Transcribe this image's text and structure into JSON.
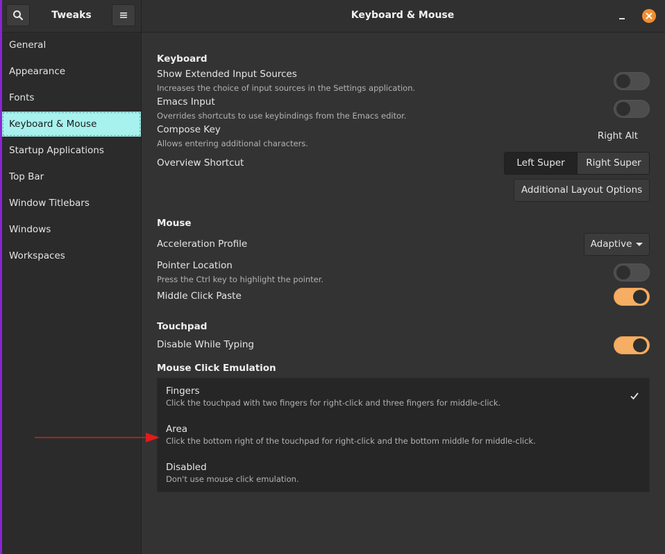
{
  "app": {
    "sidebar_title": "Tweaks",
    "page_title": "Keyboard & Mouse"
  },
  "sidebar": {
    "items": [
      {
        "label": "General",
        "selected": false
      },
      {
        "label": "Appearance",
        "selected": false
      },
      {
        "label": "Fonts",
        "selected": false
      },
      {
        "label": "Keyboard & Mouse",
        "selected": true
      },
      {
        "label": "Startup Applications",
        "selected": false
      },
      {
        "label": "Top Bar",
        "selected": false
      },
      {
        "label": "Window Titlebars",
        "selected": false
      },
      {
        "label": "Windows",
        "selected": false
      },
      {
        "label": "Workspaces",
        "selected": false
      }
    ]
  },
  "keyboard": {
    "section_title": "Keyboard",
    "extended_sources": {
      "label": "Show Extended Input Sources",
      "description": "Increases the choice of input sources in the Settings application.",
      "enabled": false
    },
    "emacs_input": {
      "label": "Emacs Input",
      "description": "Overrides shortcuts to use keybindings from the Emacs editor.",
      "enabled": false
    },
    "compose_key": {
      "label": "Compose Key",
      "description": "Allows entering additional characters.",
      "value": "Right Alt"
    },
    "overview_shortcut": {
      "label": "Overview Shortcut",
      "options": [
        "Left Super",
        "Right Super"
      ],
      "selected": "Left Super"
    },
    "additional_layout_button": "Additional Layout Options"
  },
  "mouse": {
    "section_title": "Mouse",
    "acceleration_profile": {
      "label": "Acceleration Profile",
      "value": "Adaptive"
    },
    "pointer_location": {
      "label": "Pointer Location",
      "description": "Press the Ctrl key to highlight the pointer.",
      "enabled": false
    },
    "middle_click_paste": {
      "label": "Middle Click Paste",
      "enabled": true
    }
  },
  "touchpad": {
    "section_title": "Touchpad",
    "disable_while_typing": {
      "label": "Disable While Typing",
      "enabled": true
    },
    "click_emulation": {
      "section_title": "Mouse Click Emulation",
      "options": [
        {
          "title": "Fingers",
          "description": "Click the touchpad with two fingers for right-click and three fingers for middle-click.",
          "checked": true
        },
        {
          "title": "Area",
          "description": "Click the bottom right of the touchpad for right-click and the bottom middle for middle-click.",
          "checked": false
        },
        {
          "title": "Disabled",
          "description": "Don't use mouse click emulation.",
          "checked": false
        }
      ]
    }
  },
  "colors": {
    "accent_toggle_on": "#f5ae63",
    "selection": "#a7f2ee",
    "close_button": "#f28d2f",
    "annotation_arrow": "#e01b1b",
    "left_edge": "#8a24d6"
  }
}
